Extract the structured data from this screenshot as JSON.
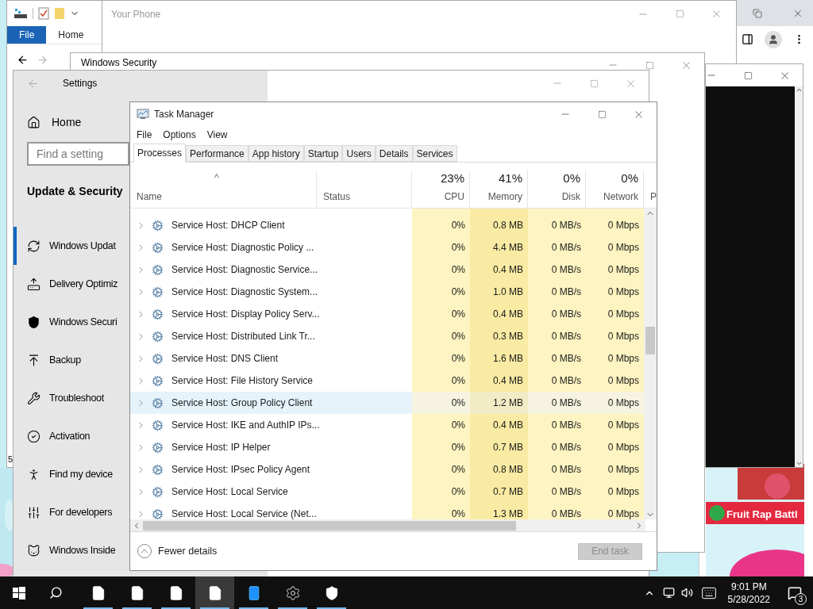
{
  "explorer": {
    "tabs": [
      {
        "label": "File",
        "selected": true
      },
      {
        "label": "Home",
        "selected": false
      }
    ],
    "status_text": "5"
  },
  "browser": {
    "banner": "Fruit Rap Battl"
  },
  "your_phone": {
    "title": "Your Phone"
  },
  "windows_security": {
    "title": "Windows Security"
  },
  "settings": {
    "title": "Settings",
    "home": "Home",
    "search": {
      "placeholder": "Find a setting"
    },
    "section": "Update & Security",
    "items": [
      {
        "label": "Windows Updat",
        "selected": true
      },
      {
        "label": "Delivery Optimiz",
        "selected": false
      },
      {
        "label": "Windows Securi",
        "selected": false
      },
      {
        "label": "Backup",
        "selected": false
      },
      {
        "label": "Troubleshoot",
        "selected": false
      },
      {
        "label": "Activation",
        "selected": false
      },
      {
        "label": "Find my device",
        "selected": false
      },
      {
        "label": "For developers",
        "selected": false
      },
      {
        "label": "Windows Inside",
        "selected": false
      }
    ]
  },
  "task_manager": {
    "title": "Task Manager",
    "menu": [
      "File",
      "Options",
      "View"
    ],
    "tabs": [
      {
        "label": "Processes",
        "selected": true
      },
      {
        "label": "Performance",
        "selected": false
      },
      {
        "label": "App history",
        "selected": false
      },
      {
        "label": "Startup",
        "selected": false
      },
      {
        "label": "Users",
        "selected": false
      },
      {
        "label": "Details",
        "selected": false
      },
      {
        "label": "Services",
        "selected": false
      }
    ],
    "sort_caret": "^",
    "columns": [
      {
        "label": "Name",
        "kind": "text"
      },
      {
        "label": "Status",
        "kind": "text"
      },
      {
        "label": "CPU",
        "usage": "23%",
        "kind": "metric"
      },
      {
        "label": "Memory",
        "usage": "41%",
        "kind": "metric"
      },
      {
        "label": "Disk",
        "usage": "0%",
        "kind": "metric"
      },
      {
        "label": "Network",
        "usage": "0%",
        "kind": "metric"
      },
      {
        "label": "P",
        "kind": "partial"
      }
    ],
    "rows": [
      {
        "name": "Service Host: DHCP Client",
        "cpu": "0%",
        "memory": "0.8 MB",
        "disk": "0 MB/s",
        "network": "0 Mbps",
        "selected": false
      },
      {
        "name": "Service Host: Diagnostic Policy ...",
        "cpu": "0%",
        "memory": "4.4 MB",
        "disk": "0 MB/s",
        "network": "0 Mbps",
        "selected": false
      },
      {
        "name": "Service Host: Diagnostic Service...",
        "cpu": "0%",
        "memory": "0.4 MB",
        "disk": "0 MB/s",
        "network": "0 Mbps",
        "selected": false
      },
      {
        "name": "Service Host: Diagnostic System...",
        "cpu": "0%",
        "memory": "1.0 MB",
        "disk": "0 MB/s",
        "network": "0 Mbps",
        "selected": false
      },
      {
        "name": "Service Host: Display Policy Serv...",
        "cpu": "0%",
        "memory": "0.4 MB",
        "disk": "0 MB/s",
        "network": "0 Mbps",
        "selected": false
      },
      {
        "name": "Service Host: Distributed Link Tr...",
        "cpu": "0%",
        "memory": "0.3 MB",
        "disk": "0 MB/s",
        "network": "0 Mbps",
        "selected": false
      },
      {
        "name": "Service Host: DNS Client",
        "cpu": "0%",
        "memory": "1.6 MB",
        "disk": "0 MB/s",
        "network": "0 Mbps",
        "selected": false
      },
      {
        "name": "Service Host: File History Service",
        "cpu": "0%",
        "memory": "0.4 MB",
        "disk": "0 MB/s",
        "network": "0 Mbps",
        "selected": false
      },
      {
        "name": "Service Host: Group Policy Client",
        "cpu": "0%",
        "memory": "1.2 MB",
        "disk": "0 MB/s",
        "network": "0 Mbps",
        "selected": true
      },
      {
        "name": "Service Host: IKE and AuthIP IPs...",
        "cpu": "0%",
        "memory": "0.4 MB",
        "disk": "0 MB/s",
        "network": "0 Mbps",
        "selected": false
      },
      {
        "name": "Service Host: IP Helper",
        "cpu": "0%",
        "memory": "0.7 MB",
        "disk": "0 MB/s",
        "network": "0 Mbps",
        "selected": false
      },
      {
        "name": "Service Host: IPsec Policy Agent",
        "cpu": "0%",
        "memory": "0.8 MB",
        "disk": "0 MB/s",
        "network": "0 Mbps",
        "selected": false
      },
      {
        "name": "Service Host: Local Service",
        "cpu": "0%",
        "memory": "0.7 MB",
        "disk": "0 MB/s",
        "network": "0 Mbps",
        "selected": false
      },
      {
        "name": "Service Host: Local Service (Net...",
        "cpu": "0%",
        "memory": "1.3 MB",
        "disk": "0 MB/s",
        "network": "0 Mbps",
        "selected": false
      }
    ],
    "fewer_details": "Fewer details",
    "end_task": {
      "label": "End task",
      "disabled": true
    }
  },
  "taskbar": {
    "apps": [
      {
        "selected": false
      },
      {
        "selected": false
      },
      {
        "selected": false
      },
      {
        "selected": true
      },
      {
        "selected": false
      },
      {
        "selected": false
      },
      {
        "selected": false
      }
    ],
    "time": "9:01 PM",
    "date": "5/28/2022",
    "notifications": "3"
  }
}
